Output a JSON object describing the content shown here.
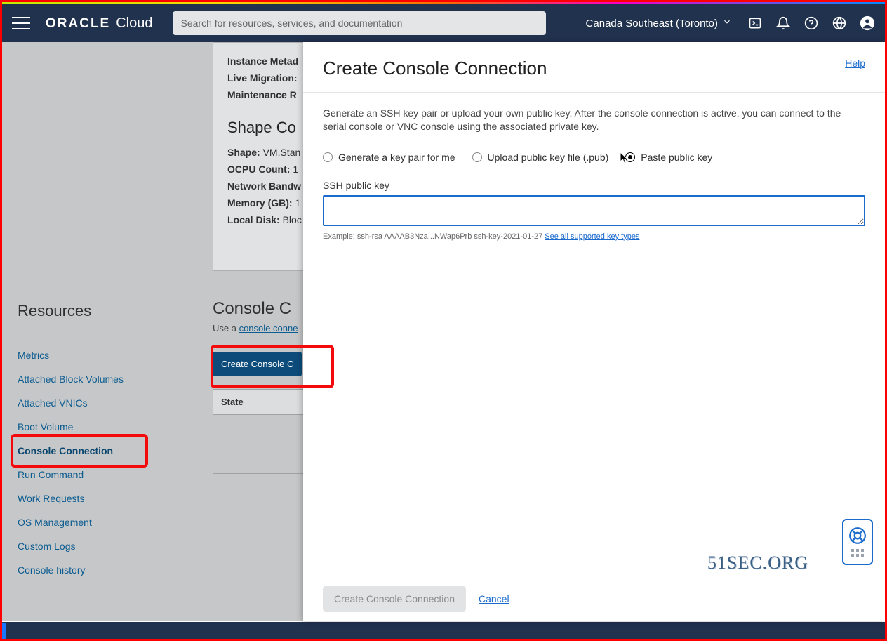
{
  "header": {
    "brand": "ORACLE",
    "product": "Cloud",
    "search_placeholder": "Search for resources, services, and documentation",
    "region": "Canada Southeast (Toronto)"
  },
  "background": {
    "lines": {
      "instance_metadata_label": "Instance Metad",
      "live_migration_label": "Live Migration:",
      "maintenance_label": "Maintenance R",
      "shape_config_heading": "Shape Co",
      "shape_label": "Shape:",
      "shape_value": "VM.Stan",
      "ocpu_label": "OCPU Count:",
      "ocpu_value": "1",
      "network_label": "Network Bandw",
      "memory_label": "Memory (GB):",
      "memory_value": "1",
      "local_disk_label": "Local Disk:",
      "local_disk_value": "Bloc"
    },
    "cc": {
      "heading": "Console C",
      "sub_prefix": "Use a ",
      "sub_link": "console conne",
      "button": "Create Console C",
      "table_col": "State"
    }
  },
  "sidebar": {
    "title": "Resources",
    "items": [
      "Metrics",
      "Attached Block Volumes",
      "Attached VNICs",
      "Boot Volume",
      "Console Connection",
      "Run Command",
      "Work Requests",
      "OS Management",
      "Custom Logs",
      "Console history"
    ],
    "active_index": 4
  },
  "panel": {
    "title": "Create Console Connection",
    "help": "Help",
    "description": "Generate an SSH key pair or upload your own public key. After the console connection is active, you can connect to the serial console or VNC console using the associated private key.",
    "radios": {
      "generate": "Generate a key pair for me",
      "upload": "Upload public key file (.pub)",
      "paste": "Paste public key"
    },
    "ssh_label": "SSH public key",
    "example_prefix": "Example: ssh-rsa AAAAB3Nza...NWap6Prb ssh-key-2021-01-27 ",
    "example_link": "See all supported key types",
    "footer": {
      "create": "Create Console Connection",
      "cancel": "Cancel"
    }
  },
  "watermark": "51SEC.ORG"
}
